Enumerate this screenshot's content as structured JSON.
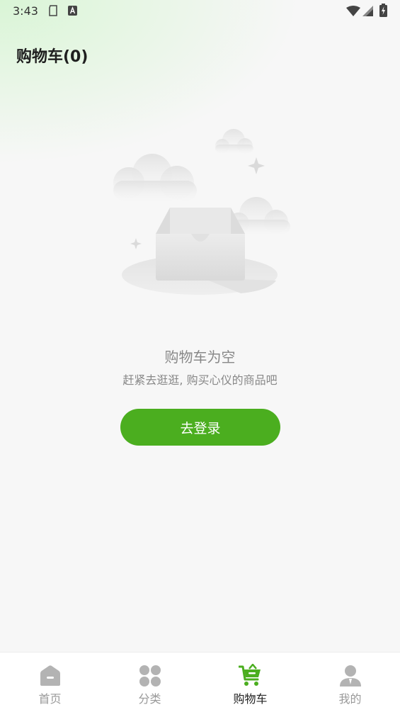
{
  "status_bar": {
    "time": "3:43",
    "icons": [
      "sd-card-icon",
      "keyboard-a-icon",
      "wifi-icon",
      "cellular-signal-icon",
      "battery-charging-icon"
    ]
  },
  "header": {
    "title": "购物车(0)"
  },
  "empty_state": {
    "title": "购物车为空",
    "subtitle": "赶紧去逛逛, 购买心仪的商品吧",
    "button_label": "去登录"
  },
  "tab_bar": {
    "items": [
      {
        "label": "首页",
        "icon": "home-icon",
        "active": false
      },
      {
        "label": "分类",
        "icon": "category-grid-icon",
        "active": false
      },
      {
        "label": "购物车",
        "icon": "shopping-cart-icon",
        "active": true
      },
      {
        "label": "我的",
        "icon": "user-profile-icon",
        "active": false
      }
    ]
  },
  "colors": {
    "accent": "#4bae1f",
    "inactive_icon": "#b3b3b3",
    "background": "#f7f7f7"
  }
}
